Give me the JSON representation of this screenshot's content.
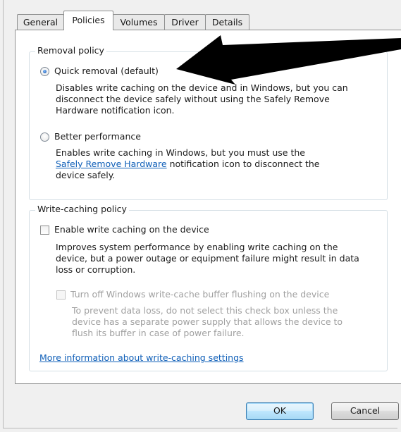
{
  "tabs": [
    {
      "label": "General",
      "active": false
    },
    {
      "label": "Policies",
      "active": true
    },
    {
      "label": "Volumes",
      "active": false
    },
    {
      "label": "Driver",
      "active": false
    },
    {
      "label": "Details",
      "active": false
    }
  ],
  "removal_policy": {
    "legend": "Removal policy",
    "quick_removal": {
      "label": "Quick removal (default)",
      "selected": true,
      "description_lines": [
        "Disables write caching on the device and in Windows, but you can",
        "disconnect the device safely without using the Safely Remove",
        "Hardware notification icon."
      ]
    },
    "better_performance": {
      "label": "Better performance",
      "selected": false,
      "description_line1": "Enables write caching in Windows, but you must use the",
      "description_link": "Safely Remove Hardware",
      "description_line2_rest": " notification icon to disconnect the",
      "description_line3": "device safely."
    }
  },
  "write_caching_policy": {
    "legend": "Write-caching policy",
    "enable_write_caching": {
      "label": "Enable write caching on the device",
      "checked": false,
      "description_lines": [
        "Improves system performance by enabling write caching on the",
        "device, but a power outage or equipment failure might result in data",
        "loss or corruption."
      ]
    },
    "turn_off_flushing": {
      "label": "Turn off Windows write-cache buffer flushing on the device",
      "checked": false,
      "enabled": false,
      "description_lines": [
        "To prevent data loss, do not select this check box unless the",
        "device has a separate power supply that allows the device to",
        "flush its buffer in case of power failure."
      ]
    }
  },
  "more_info_link": "More information about write-caching settings",
  "buttons": {
    "ok": "OK",
    "cancel": "Cancel"
  },
  "colors": {
    "link": "#0f5fb8",
    "arrow": "#000000",
    "disabled_text": "#a0a0a0"
  }
}
